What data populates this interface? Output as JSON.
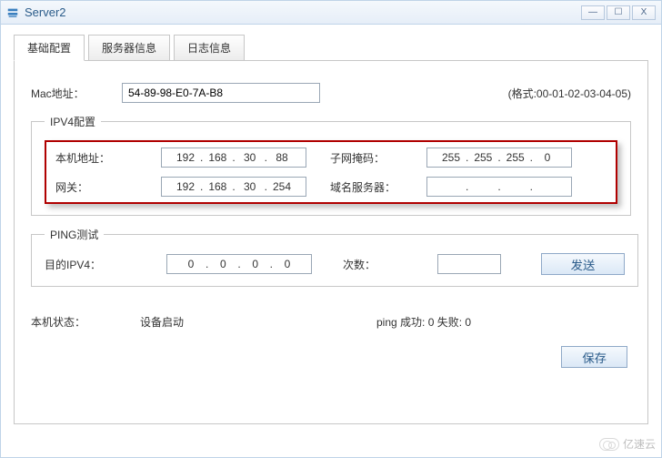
{
  "window": {
    "title": "Server2"
  },
  "tabs": {
    "basic": "基础配置",
    "info": "服务器信息",
    "log": "日志信息"
  },
  "mac": {
    "label": "Mac地址：",
    "value": "54-89-98-E0-7A-B8",
    "hint": "(格式:00-01-02-03-04-05)"
  },
  "ipv4": {
    "legend": "IPV4配置",
    "host_label": "本机地址：",
    "host": [
      "192",
      "168",
      "30",
      "88"
    ],
    "mask_label": "子网掩码：",
    "mask": [
      "255",
      "255",
      "255",
      "0"
    ],
    "gw_label": "网关：",
    "gw": [
      "192",
      "168",
      "30",
      "254"
    ],
    "dns_label": "域名服务器：",
    "dns": [
      "",
      "",
      "",
      ""
    ]
  },
  "ping": {
    "legend": "PING测试",
    "ip_label": "目的IPV4：",
    "ip": [
      "0",
      "0",
      "0",
      "0"
    ],
    "count_label": "次数：",
    "count": "",
    "send": "发送"
  },
  "status": {
    "host_state_label": "本机状态：",
    "device_state": "设备启动",
    "ping_result": "ping 成功: 0 失败: 0"
  },
  "save": "保存",
  "watermark": "亿速云"
}
